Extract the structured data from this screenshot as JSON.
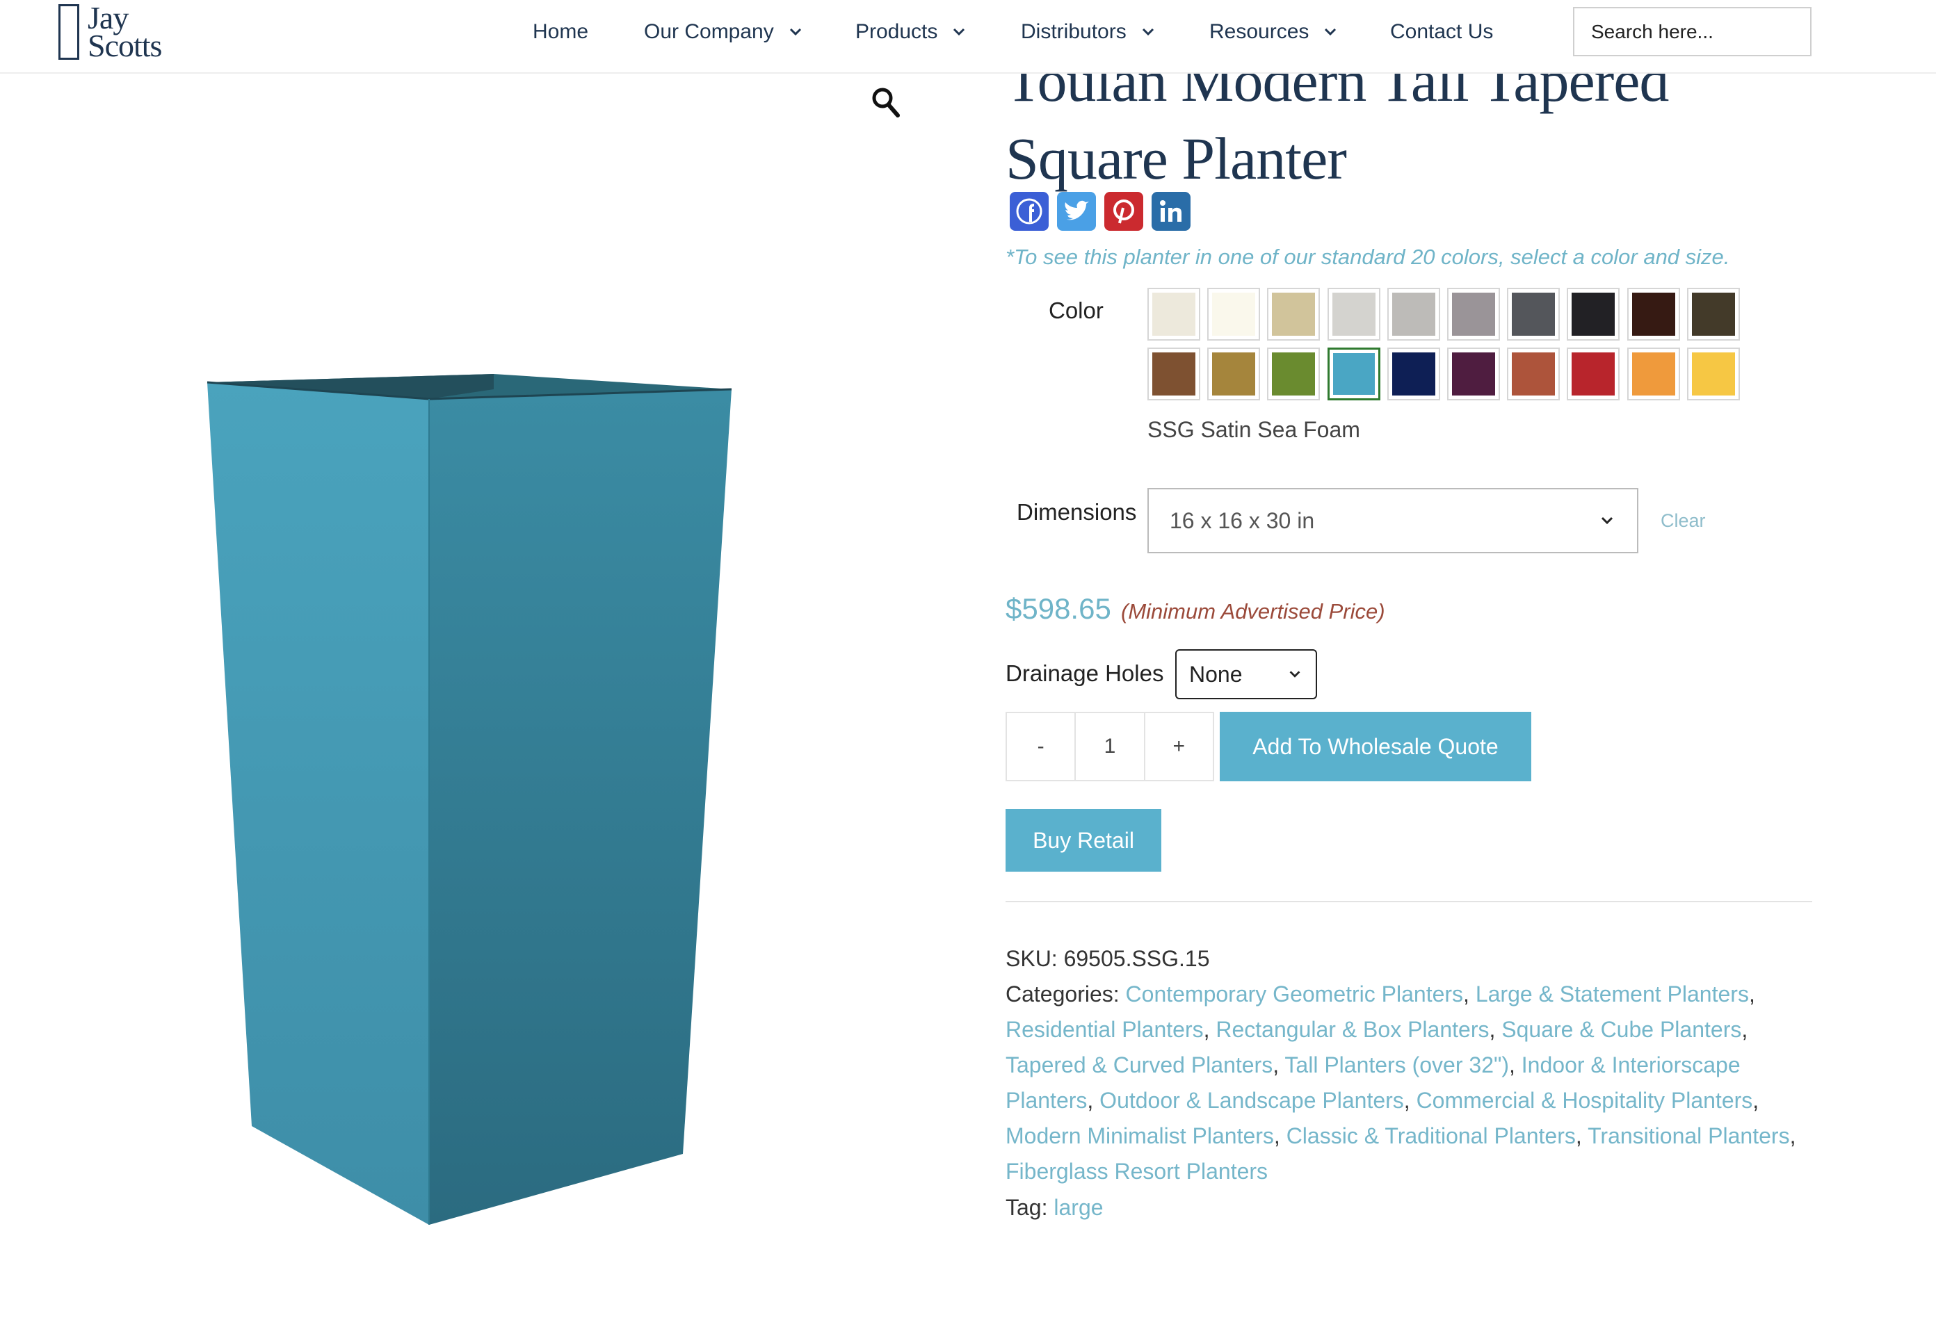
{
  "header": {
    "logo_line1": "Jay",
    "logo_line2": "Scotts",
    "nav": [
      {
        "label": "Home",
        "has_dropdown": false
      },
      {
        "label": "Our Company",
        "has_dropdown": true
      },
      {
        "label": "Products",
        "has_dropdown": true
      },
      {
        "label": "Distributors",
        "has_dropdown": true
      },
      {
        "label": "Resources",
        "has_dropdown": true
      },
      {
        "label": "Contact Us",
        "has_dropdown": false
      }
    ],
    "search_placeholder": "Search here..."
  },
  "product": {
    "title": "Toulan Modern Tall Tapered Square Planter",
    "image_color": "#3a90a8",
    "share_icons": [
      {
        "icon": "facebook-icon",
        "color": "#3b5fd6"
      },
      {
        "icon": "twitter-icon",
        "color": "#4aa0e6"
      },
      {
        "icon": "pinterest-icon",
        "color": "#cb2a2f"
      },
      {
        "icon": "linkedin-icon",
        "color": "#2a6da8"
      }
    ],
    "color_note": "*To see this planter in one of our standard 20 colors, select a color and size.",
    "color_label": "Color",
    "swatches": [
      {
        "color": "#ede9dc",
        "selected": false
      },
      {
        "color": "#faf8ec",
        "selected": false
      },
      {
        "color": "#d1c49b",
        "selected": false
      },
      {
        "color": "#d4d3cf",
        "selected": false
      },
      {
        "color": "#bdbbb8",
        "selected": false
      },
      {
        "color": "#9a9498",
        "selected": false
      },
      {
        "color": "#54565b",
        "selected": false
      },
      {
        "color": "#222125",
        "selected": false
      },
      {
        "color": "#361a13",
        "selected": false
      },
      {
        "color": "#433a29",
        "selected": false
      },
      {
        "color": "#7e5131",
        "selected": false
      },
      {
        "color": "#a5853c",
        "selected": false
      },
      {
        "color": "#6a8b2f",
        "selected": false
      },
      {
        "color": "#4aa6c4",
        "selected": true
      },
      {
        "color": "#0e1f55",
        "selected": false
      },
      {
        "color": "#4f1d40",
        "selected": false
      },
      {
        "color": "#ad543b",
        "selected": false
      },
      {
        "color": "#b8252c",
        "selected": false
      },
      {
        "color": "#ef9a3c",
        "selected": false
      },
      {
        "color": "#f6c744",
        "selected": false
      }
    ],
    "selected_color_name": "SSG Satin Sea Foam",
    "dimensions_label": "Dimensions",
    "dimensions_value": "16 x 16 x 30 in",
    "clear_label": "Clear",
    "price": "$598.65",
    "price_note": "(Minimum Advertised Price)",
    "drainage_label": "Drainage Holes",
    "drainage_value": "None",
    "qty_minus": "-",
    "qty_value": "1",
    "qty_plus": "+",
    "add_quote_label": "Add To Wholesale Quote",
    "buy_retail_label": "Buy Retail",
    "sku_label": "SKU:",
    "sku_value": "69505.SSG.15",
    "categories_label": "Categories:",
    "categories": [
      "Contemporary Geometric Planters",
      "Large & Statement Planters",
      "Residential Planters",
      "Rectangular & Box Planters",
      "Square & Cube Planters",
      "Tapered & Curved Planters",
      "Tall Planters (over 32\")",
      "Indoor & Interiorscape Planters",
      "Outdoor & Landscape Planters",
      "Commercial & Hospitality Planters",
      "Modern Minimalist Planters",
      "Classic & Traditional Planters",
      "Transitional Planters",
      "Fiberglass Resort Planters"
    ],
    "tag_label": "Tag:",
    "tag_value": "large"
  }
}
